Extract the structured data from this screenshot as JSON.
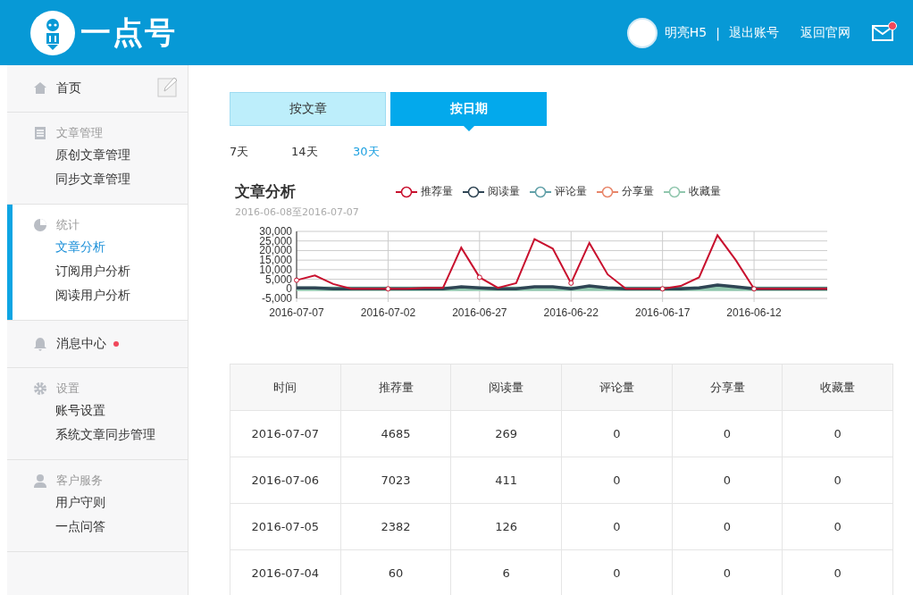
{
  "header": {
    "logo_text": "一点号",
    "user_name": "明亮H5",
    "separator": "|",
    "links": [
      "退出账号",
      "返回官网"
    ],
    "mail_unread": true
  },
  "sidebar": {
    "sections": [
      {
        "kind": "link",
        "label": "首页",
        "unread": false,
        "active": false
      },
      {
        "kind": "group",
        "title": "文章管理",
        "active": false,
        "items": [
          {
            "label": "原创文章管理",
            "selected": false
          },
          {
            "label": "同步文章管理",
            "selected": false
          }
        ]
      },
      {
        "kind": "group",
        "title": "统计",
        "active": true,
        "items": [
          {
            "label": "文章分析",
            "selected": true
          },
          {
            "label": "订阅用户分析",
            "selected": false
          },
          {
            "label": "阅读用户分析",
            "selected": false
          }
        ]
      },
      {
        "kind": "link",
        "label": "消息中心",
        "unread": true,
        "active": false
      },
      {
        "kind": "group",
        "title": "设置",
        "active": false,
        "items": [
          {
            "label": "账号设置",
            "selected": false
          },
          {
            "label": "系统文章同步管理",
            "selected": false
          }
        ]
      },
      {
        "kind": "group",
        "title": "客户服务",
        "active": false,
        "items": [
          {
            "label": "用户守则",
            "selected": false
          },
          {
            "label": "一点问答",
            "selected": false
          }
        ]
      }
    ]
  },
  "tabs": [
    {
      "label": "按文章",
      "selected": false
    },
    {
      "label": "按日期",
      "selected": true
    }
  ],
  "ranges": [
    {
      "label": "7天",
      "selected": false
    },
    {
      "label": "14天",
      "selected": false
    },
    {
      "label": "30天",
      "selected": true
    }
  ],
  "chart": {
    "subtitle": "2016-06-08至2016-07-07",
    "chart_data": {
      "type": "line",
      "title": "文章分析",
      "grid": true,
      "legend": true,
      "xlim": [
        "2016-07-07",
        "2016-06-08"
      ],
      "x": [
        "2016-07-07",
        "2016-07-06",
        "2016-07-05",
        "2016-07-04",
        "2016-07-03",
        "2016-07-02",
        "2016-07-01",
        "2016-06-30",
        "2016-06-29",
        "2016-06-28",
        "2016-06-27",
        "2016-06-26",
        "2016-06-25",
        "2016-06-24",
        "2016-06-23",
        "2016-06-22",
        "2016-06-21",
        "2016-06-20",
        "2016-06-19",
        "2016-06-18",
        "2016-06-17",
        "2016-06-16",
        "2016-06-15",
        "2016-06-14",
        "2016-06-13",
        "2016-06-12",
        "2016-06-11",
        "2016-06-10",
        "2016-06-09",
        "2016-06-08"
      ],
      "series": [
        {
          "name": "推荐量",
          "color": "#c8102e",
          "values": [
            4500,
            7000,
            2500,
            0,
            0,
            0,
            0,
            500,
            500,
            21500,
            6000,
            500,
            3000,
            26000,
            21000,
            3000,
            24000,
            7500,
            0,
            0,
            0,
            1500,
            6000,
            28000,
            15000,
            0,
            0,
            0,
            0,
            0
          ]
        },
        {
          "name": "阅读量",
          "color": "#2f4554",
          "values": [
            500,
            500,
            0,
            0,
            0,
            0,
            0,
            0,
            0,
            1000,
            500,
            0,
            0,
            1000,
            1000,
            0,
            1500,
            500,
            0,
            0,
            0,
            0,
            500,
            2000,
            1000,
            0,
            0,
            0,
            0,
            0
          ]
        },
        {
          "name": "评论量",
          "color": "#61a0a8",
          "values": [
            null,
            null,
            null,
            null,
            null,
            null,
            null,
            null,
            null,
            null,
            null,
            null,
            null,
            null,
            null,
            null,
            null,
            null,
            null,
            null,
            null,
            null,
            null,
            null,
            null,
            null,
            null,
            null,
            null,
            null
          ]
        },
        {
          "name": "分享量",
          "color": "#e8866a",
          "values": [
            null,
            null,
            null,
            null,
            null,
            null,
            null,
            null,
            null,
            null,
            null,
            null,
            null,
            null,
            null,
            null,
            null,
            null,
            null,
            null,
            null,
            null,
            null,
            null,
            null,
            null,
            null,
            null,
            null,
            null
          ]
        },
        {
          "name": "收藏量",
          "color": "#91c7ae",
          "values": [
            0,
            0,
            0,
            0,
            0,
            0,
            0,
            0,
            0,
            0,
            0,
            0,
            0,
            0,
            0,
            0,
            0,
            0,
            0,
            0,
            0,
            0,
            0,
            0,
            0,
            0,
            0,
            0,
            0,
            0
          ]
        }
      ],
      "ylim": [
        -5000,
        30000
      ],
      "yticks": [
        {
          "value": -5000,
          "label": "-5,000"
        },
        0,
        {
          "value": 5000,
          "label": "5,000"
        },
        {
          "value": 10000,
          "label": "10,000"
        },
        {
          "value": 15000,
          "label": "15,000"
        },
        {
          "value": 20000,
          "label": "20,000"
        },
        {
          "value": 25000,
          "label": "25,000"
        },
        {
          "value": 30000,
          "label": "30,000"
        }
      ],
      "xticks": [
        "2016-07-07",
        "2016-07-02",
        "2016-06-27",
        "2016-06-22",
        "2016-06-17",
        "2016-06-12"
      ]
    }
  },
  "table": {
    "columns": [
      "时间",
      "推荐量",
      "阅读量",
      "评论量",
      "分享量",
      "收藏量"
    ],
    "rows": [
      [
        "2016-07-07",
        "4685",
        "269",
        "0",
        "0",
        "0"
      ],
      [
        "2016-07-06",
        "7023",
        "411",
        "0",
        "0",
        "0"
      ],
      [
        "2016-07-05",
        "2382",
        "126",
        "0",
        "0",
        "0"
      ],
      [
        "2016-07-04",
        "60",
        "6",
        "0",
        "0",
        "0"
      ]
    ]
  }
}
